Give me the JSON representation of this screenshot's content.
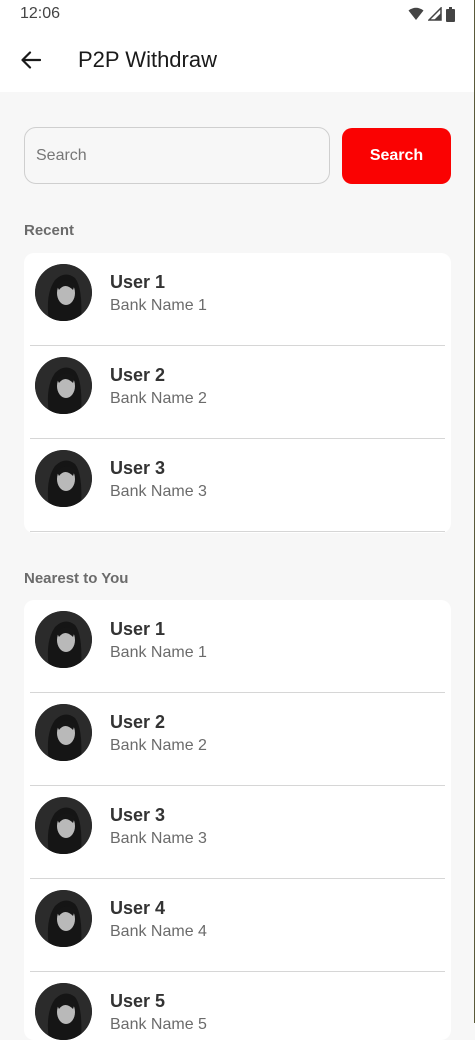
{
  "status_bar": {
    "time": "12:06"
  },
  "app_bar": {
    "title": "P2P Withdraw"
  },
  "search": {
    "placeholder": "Search",
    "value": "",
    "button_label": "Search"
  },
  "recent": {
    "title": "Recent",
    "items": [
      {
        "name": "User 1",
        "bank": "Bank Name 1"
      },
      {
        "name": "User 2",
        "bank": "Bank Name 2"
      },
      {
        "name": "User 3",
        "bank": "Bank Name 3"
      }
    ]
  },
  "nearest": {
    "title": "Nearest to You",
    "items": [
      {
        "name": "User 1",
        "bank": "Bank Name 1"
      },
      {
        "name": "User 2",
        "bank": "Bank Name 2"
      },
      {
        "name": "User 3",
        "bank": "Bank Name 3"
      },
      {
        "name": "User 4",
        "bank": "Bank Name 4"
      },
      {
        "name": "User 5",
        "bank": "Bank Name 5"
      }
    ]
  },
  "colors": {
    "accent": "#fa0202",
    "background": "#f7f7f7",
    "card": "#ffffff"
  }
}
